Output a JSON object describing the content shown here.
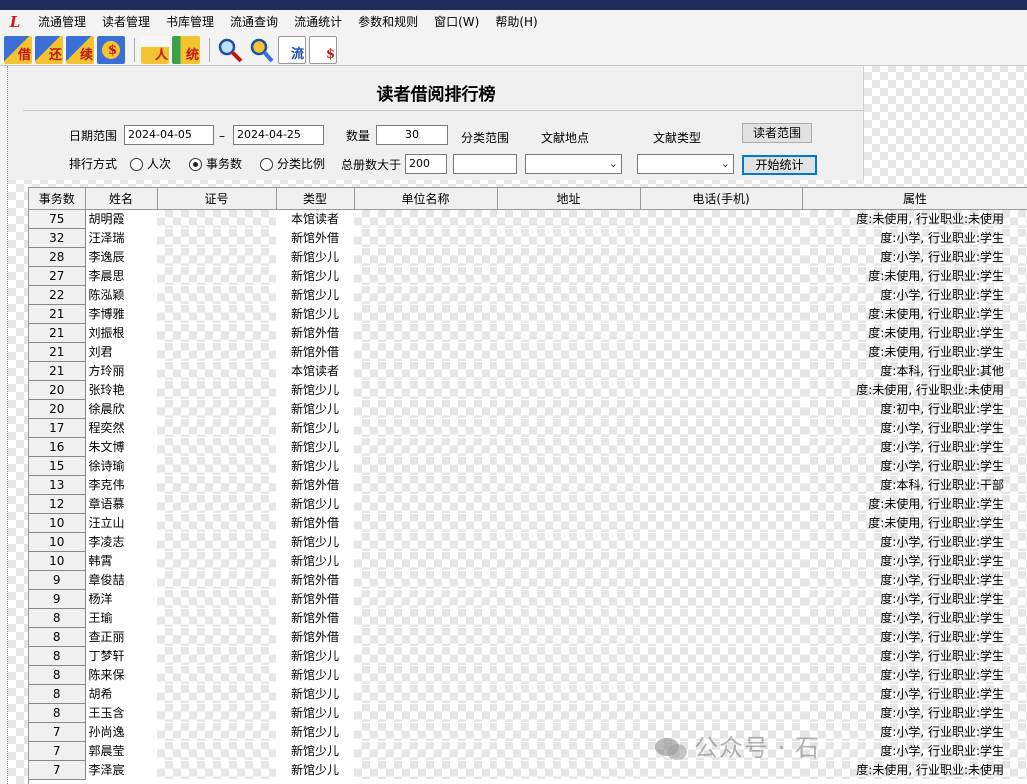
{
  "menu": [
    "流通管理",
    "读者管理",
    "书库管理",
    "流通查询",
    "流通统计",
    "参数和规则",
    "窗口(W)",
    "帮助(H)"
  ],
  "toolbar": {
    "group1": [
      {
        "icon": "borrow-icon",
        "char": "借"
      },
      {
        "icon": "return-icon",
        "char": "还"
      },
      {
        "icon": "renew-icon",
        "char": "续"
      },
      {
        "icon": "fine-icon",
        "char": "$"
      }
    ],
    "group2": [
      {
        "icon": "reader-icon",
        "char": "人"
      },
      {
        "icon": "stats-icon",
        "char": "统"
      }
    ],
    "group3": [
      {
        "icon": "search-icon",
        "char": ""
      },
      {
        "icon": "reader-search-icon",
        "char": ""
      },
      {
        "icon": "circulation-chart-icon",
        "char": "流"
      },
      {
        "icon": "fine-chart-icon",
        "char": "$"
      }
    ]
  },
  "form": {
    "title": "读者借阅排行榜",
    "date_label": "日期范围",
    "date_from": "2024-04-05",
    "date_sep": "–",
    "date_to": "2024-04-25",
    "count_label": "数量",
    "count_value": "30",
    "category_label": "分类范围",
    "location_label": "文献地点",
    "doctype_label": "文献类型",
    "reader_scope_button": "读者范围",
    "rank_label": "排行方式",
    "radio_options": [
      "人次",
      "事务数",
      "分类比例"
    ],
    "radio_selected": 1,
    "total_label": "总册数大于",
    "total_value": "200",
    "start_button": "开始统计"
  },
  "table": {
    "columns": [
      "事务数",
      "姓名",
      "证号",
      "类型",
      "单位名称",
      "地址",
      "电话(手机)",
      "属性"
    ],
    "rows": [
      {
        "count": "75",
        "name": "胡明霞",
        "type": "本馆读者",
        "attr": "度:未使用,  行业职业:未使用"
      },
      {
        "count": "32",
        "name": "汪泽瑞",
        "type": "新馆外借",
        "attr": "度:小学,  行业职业:学生"
      },
      {
        "count": "28",
        "name": "李逸辰",
        "type": "新馆少儿",
        "attr": "度:小学,  行业职业:学生"
      },
      {
        "count": "27",
        "name": "李晨思",
        "type": "新馆少儿",
        "attr": "度:未使用,  行业职业:学生"
      },
      {
        "count": "22",
        "name": "陈泓颖",
        "type": "新馆少儿",
        "attr": "度:小学,  行业职业:学生"
      },
      {
        "count": "21",
        "name": "李博雅",
        "type": "新馆少儿",
        "attr": "度:未使用,  行业职业:学生"
      },
      {
        "count": "21",
        "name": "刘振根",
        "type": "新馆外借",
        "attr": "度:未使用,  行业职业:学生"
      },
      {
        "count": "21",
        "name": "刘君",
        "type": "新馆外借",
        "attr": "度:未使用,  行业职业:学生"
      },
      {
        "count": "21",
        "name": "方玲丽",
        "type": "本馆读者",
        "attr": "度:本科,  行业职业:其他"
      },
      {
        "count": "20",
        "name": "张玲艳",
        "type": "新馆少儿",
        "attr": "度:未使用,  行业职业:未使用"
      },
      {
        "count": "20",
        "name": "徐晨欣",
        "type": "新馆少儿",
        "attr": "度:初中,  行业职业:学生"
      },
      {
        "count": "17",
        "name": "程奕然",
        "type": "新馆少儿",
        "attr": "度:小学,  行业职业:学生"
      },
      {
        "count": "16",
        "name": "朱文博",
        "type": "新馆少儿",
        "attr": "度:小学,  行业职业:学生"
      },
      {
        "count": "15",
        "name": "徐诗瑜",
        "type": "新馆少儿",
        "attr": "度:小学,  行业职业:学生"
      },
      {
        "count": "13",
        "name": "李克伟",
        "type": "新馆外借",
        "attr": "度:本科,  行业职业:干部"
      },
      {
        "count": "12",
        "name": "章语慕",
        "type": "新馆少儿",
        "attr": "度:未使用,  行业职业:学生"
      },
      {
        "count": "10",
        "name": "汪立山",
        "type": "新馆外借",
        "attr": "度:未使用,  行业职业:学生"
      },
      {
        "count": "10",
        "name": "李凌志",
        "type": "新馆少儿",
        "attr": "度:小学,  行业职业:学生"
      },
      {
        "count": "10",
        "name": "韩霄",
        "type": "新馆少儿",
        "attr": "度:小学,  行业职业:学生"
      },
      {
        "count": "9",
        "name": "章俊喆",
        "type": "新馆外借",
        "attr": "度:小学,  行业职业:学生"
      },
      {
        "count": "9",
        "name": "杨洋",
        "type": "新馆外借",
        "attr": "度:小学,  行业职业:学生"
      },
      {
        "count": "8",
        "name": "王瑜",
        "type": "新馆外借",
        "attr": "度:小学,  行业职业:学生"
      },
      {
        "count": "8",
        "name": "查正丽",
        "type": "新馆外借",
        "attr": "度:小学,  行业职业:学生"
      },
      {
        "count": "8",
        "name": "丁梦轩",
        "type": "新馆少儿",
        "attr": "度:小学,  行业职业:学生"
      },
      {
        "count": "8",
        "name": "陈来保",
        "type": "新馆少儿",
        "attr": "度:小学,  行业职业:学生"
      },
      {
        "count": "8",
        "name": "胡希",
        "type": "新馆少儿",
        "attr": "度:小学,  行业职业:学生"
      },
      {
        "count": "8",
        "name": "王玉含",
        "type": "新馆少儿",
        "attr": "度:小学,  行业职业:学生"
      },
      {
        "count": "7",
        "name": "孙尚逸",
        "type": "新馆少儿",
        "attr": "度:小学,  行业职业:学生"
      },
      {
        "count": "7",
        "name": "郭晨莹",
        "type": "新馆少儿",
        "attr": "度:小学,  行业职业:学生"
      },
      {
        "count": "7",
        "name": "李泽宸",
        "type": "新馆少儿",
        "attr": "度:未使用,  行业职业:未使用"
      }
    ]
  },
  "watermark": "公众号 · 石"
}
